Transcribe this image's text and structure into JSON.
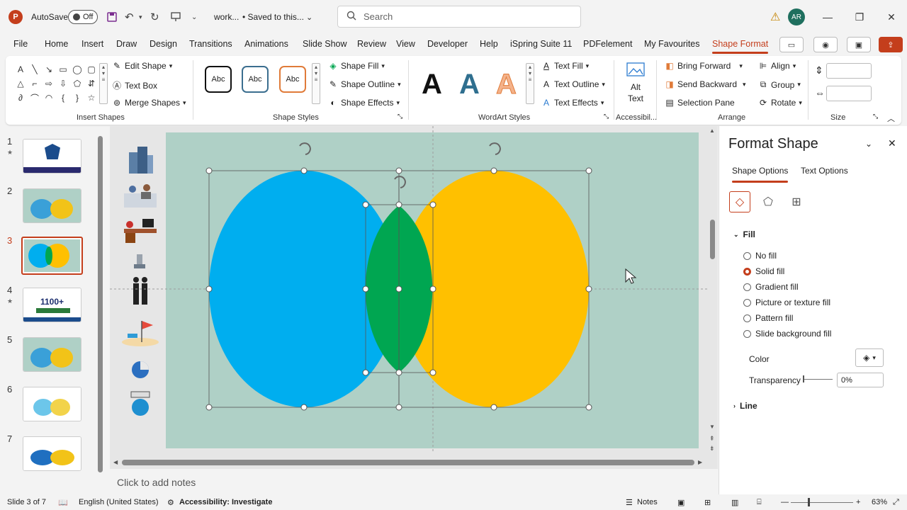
{
  "titlebar": {
    "app_letter": "P",
    "autosave_label": "AutoSave",
    "autosave_state": "Off",
    "doc_name": "work...",
    "save_status": "• Saved to this...",
    "search_placeholder": "Search",
    "user_initials": "AR"
  },
  "menu": {
    "tabs": [
      "File",
      "Home",
      "Insert",
      "Draw",
      "Design",
      "Transitions",
      "Animations",
      "Slide Show",
      "Review",
      "View",
      "Developer",
      "Help",
      "iSpring Suite 11",
      "PDFelement",
      "My Favourites",
      "Shape Format"
    ],
    "active_tab": "Shape Format"
  },
  "ribbon": {
    "insert_shapes": {
      "label": "Insert Shapes",
      "edit_shape": "Edit Shape",
      "text_box": "Text Box",
      "merge_shapes": "Merge Shapes"
    },
    "shape_styles": {
      "label": "Shape Styles",
      "swatch_text": "Abc",
      "shape_fill": "Shape Fill",
      "shape_outline": "Shape Outline",
      "shape_effects": "Shape Effects"
    },
    "wordart_styles": {
      "label": "WordArt Styles",
      "letter": "A",
      "text_fill": "Text Fill",
      "text_outline": "Text Outline",
      "text_effects": "Text Effects"
    },
    "accessibility": {
      "label": "Accessibil...",
      "alt_text_line1": "Alt",
      "alt_text_line2": "Text"
    },
    "arrange": {
      "label": "Arrange",
      "bring_forward": "Bring Forward",
      "send_backward": "Send Backward",
      "selection_pane": "Selection Pane",
      "align": "Align",
      "group": "Group",
      "rotate": "Rotate"
    },
    "size": {
      "label": "Size"
    }
  },
  "slides": {
    "numbers": [
      "1",
      "2",
      "3",
      "4",
      "5",
      "6",
      "7"
    ],
    "active": "3",
    "slide4_text": "1100+"
  },
  "notes_placeholder": "Click to add notes",
  "format_pane": {
    "title": "Format Shape",
    "tab_shape_options": "Shape Options",
    "tab_text_options": "Text Options",
    "fill_header": "Fill",
    "fill_options": [
      "No fill",
      "Solid fill",
      "Gradient fill",
      "Picture or texture fill",
      "Pattern fill",
      "Slide background fill"
    ],
    "selected_fill": "Solid fill",
    "color_label": "Color",
    "transparency_label": "Transparency",
    "transparency_value": "0%",
    "line_header": "Line"
  },
  "status": {
    "slide_info": "Slide 3 of 7",
    "language": "English (United States)",
    "accessibility": "Accessibility: Investigate",
    "notes": "Notes",
    "zoom": "63%"
  },
  "colors": {
    "accent": "#c43e1c",
    "circle_left": "#00aeef",
    "circle_right": "#ffc000",
    "overlap": "#00a651",
    "slide_bg": "#afd0c6"
  }
}
